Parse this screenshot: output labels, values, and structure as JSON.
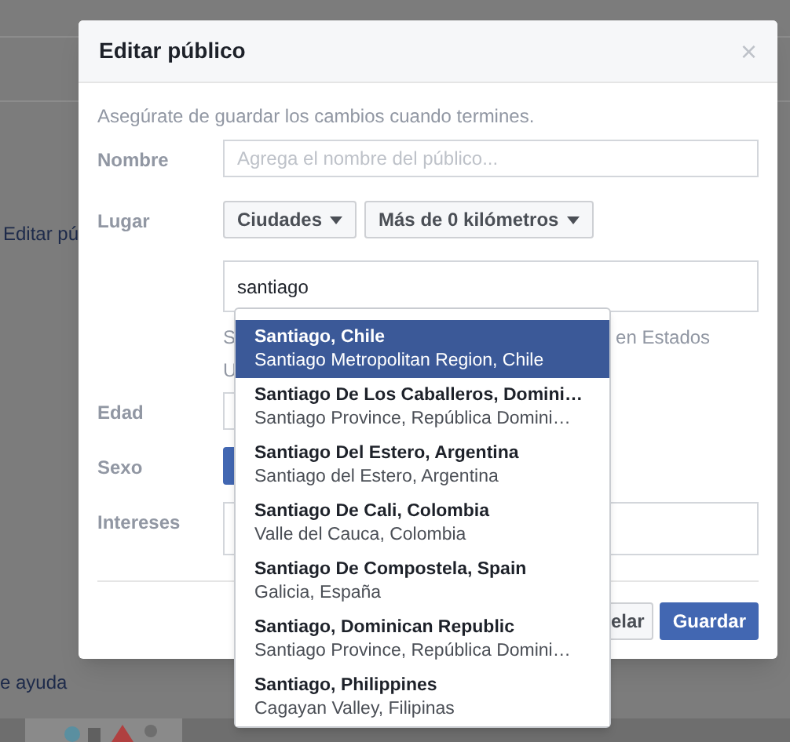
{
  "background": {
    "left_link": "Editar pú",
    "bottom_link": "e ayuda"
  },
  "dialog": {
    "title": "Editar público",
    "close": "×",
    "intro": "Asegúrate de guardar los cambios cuando termines.",
    "name_field": {
      "label": "Nombre",
      "placeholder": "Agrega el nombre del público..."
    },
    "location": {
      "label": "Lugar",
      "type_button": "Ciudades",
      "radius_button": "Más de 0 kilómetros",
      "search_value": "santiago",
      "hint_line1_start": "S",
      "hint_line1_end": "en Estados",
      "hint_line2_start": "U"
    },
    "age": {
      "label": "Edad"
    },
    "gender": {
      "label": "Sexo"
    },
    "interests": {
      "label": "Intereses"
    },
    "buttons": [
      {
        "label": "elar",
        "kind": "secondary"
      },
      {
        "label": "Guardar",
        "kind": "primary"
      }
    ]
  },
  "suggestions": [
    {
      "city": "Santiago, Chile",
      "region": "Santiago Metropolitan Region, Chile",
      "selected": true
    },
    {
      "city": "Santiago De Los Caballeros, Domini…",
      "region": "Santiago Province, República Domini…",
      "selected": false
    },
    {
      "city": "Santiago Del Estero, Argentina",
      "region": "Santiago del Estero, Argentina",
      "selected": false
    },
    {
      "city": "Santiago De Cali, Colombia",
      "region": "Valle del Cauca, Colombia",
      "selected": false
    },
    {
      "city": "Santiago De Compostela, Spain",
      "region": "Galicia, España",
      "selected": false
    },
    {
      "city": "Santiago, Dominican Republic",
      "region": "Santiago Province, República Domini…",
      "selected": false
    },
    {
      "city": "Santiago, Philippines",
      "region": "Cagayan Valley, Filipinas",
      "selected": false
    }
  ]
}
